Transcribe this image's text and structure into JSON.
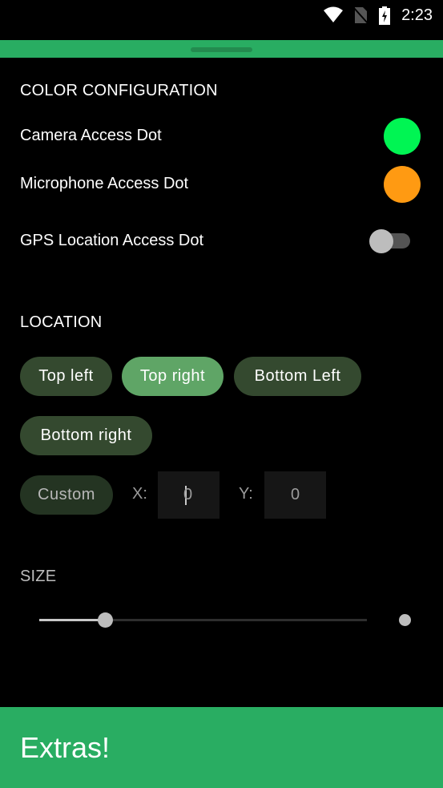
{
  "status_bar": {
    "time": "2:23",
    "icons": [
      "wifi-icon",
      "no-sim-icon",
      "battery-charging-icon"
    ]
  },
  "sheet": {
    "handle": "drag-handle"
  },
  "color_configuration": {
    "title": "COLOR CONFIGURATION",
    "items": [
      {
        "label": "Camera Access Dot",
        "type": "color",
        "color": "#00f553"
      },
      {
        "label": "Microphone Access Dot",
        "type": "color",
        "color": "#ff9a12"
      },
      {
        "label": "GPS Location Access Dot",
        "type": "toggle",
        "enabled": false
      }
    ]
  },
  "location": {
    "title": "LOCATION",
    "options": [
      {
        "label": "Top left",
        "selected": false
      },
      {
        "label": "Top right",
        "selected": true
      },
      {
        "label": "Bottom Left",
        "selected": false
      },
      {
        "label": "Bottom right",
        "selected": false
      },
      {
        "label": "Custom",
        "selected": false
      }
    ],
    "x_label": "X:",
    "x_value": "0",
    "y_label": "Y:",
    "y_value": "0"
  },
  "size": {
    "title": "SIZE",
    "slider_fraction": 0.2
  },
  "extras": {
    "label": "Extras!"
  },
  "colors": {
    "accent_green": "#29ad62",
    "chip_default": "#34492f",
    "chip_selected": "#5fa566"
  }
}
